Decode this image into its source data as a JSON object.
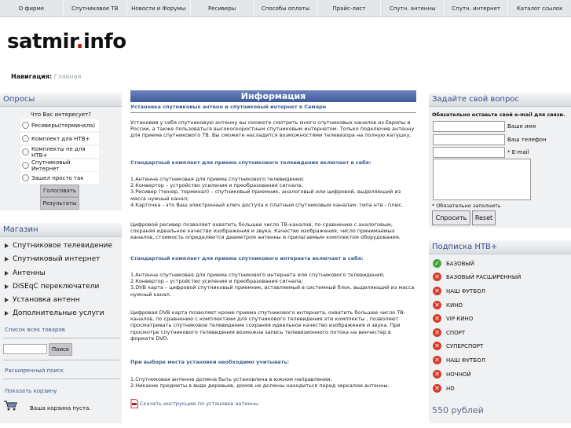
{
  "topnav": [
    "О фирме",
    "Спутниковое ТВ",
    "Новости и Форумы",
    "Ресиверы",
    "Способы оплаты",
    "Прайс-лист",
    "Спутн. антенны",
    "Спутн. интернет",
    "Каталог ссылок"
  ],
  "logo": {
    "main": "satmir",
    "dot": ".",
    "tld": "info"
  },
  "breadcrumb": {
    "label": "Навигация:",
    "home": "Главная"
  },
  "polls": {
    "title": "Опросы",
    "question": "Что Вас интересует?",
    "options": [
      "Ресиверы(терминала)",
      "Комплект для НТВ+",
      "Комплекты не для НТВ+",
      "Спутниковый Интернет",
      "Зашел просто так"
    ],
    "vote": "Голосовать",
    "results": "Результаты"
  },
  "shop": {
    "title": "Магазин",
    "items": [
      "Спутниковое телевидение",
      "Спутниковый интернет",
      "Антенны",
      "DiSEqC переключатели",
      "Установка антенн",
      "Дополнительные услуги"
    ],
    "all_products": "Список всех товаров",
    "search_btn": "Поиск",
    "advanced_search": "Расширенный поиск",
    "show_cart": "Показать корзину",
    "cart_empty": "Ваша корзина пуста."
  },
  "info": {
    "title": "Информация",
    "subtitle": "Установка спутниковых антенн и спутниковый интернет в Самаре",
    "p1": "Установив у себя спутниковую антенну вы сможете смотреть много спутниковых каналов из Европы и России, а также пользоваться высокоскоростным спутниковым интернетом. Только подключив антенну для приема спутникового ТВ. Вы сможете насладится возможностями телевизора на полную катушку.",
    "h1": "Стандартный комплект для приема спутникового телевидения включает в себя:",
    "list1": [
      "1.Антенна спутниковая для приема спутникового телевидения;",
      "2.Конвертор – устройство усиления и преобразования сигнала;",
      "3.Ресивер (тюнер, терминал) – спутниковый приемник, аналоговый или цифровой, выделяющий из масса нужный канал;",
      "4.Карточка - это Ваш электронный ключ доступа к платным спутниковым каналам. типа нтв - плюс."
    ],
    "p2": "Цифровой ресивер позволяет охватить большее число ТВ-каналов, по сравнению с аналоговым, сохраняя идеальное качество изображения и звука. Качество изображения, число принимаемых каналов, стоимость определяются диаметром антенны и прилагаемым комплектом оборудования.",
    "h2": "Стандартный комплект для приема спутникового интернета включает в себя:",
    "list2": [
      "1.Антенна спутниковая для приема спутникового интернета или спутникового телевидения;",
      "2.Конвертор – устройство усиления и преобразования сигнала;",
      "3.DVB карта – цифровой спутниковый приемник, вставляемый в системный блок, выделяющий из масса нужный канал."
    ],
    "p3": "Цифровая DVB карта позволяет кроме приема спутникового интернета, охватить большее число ТВ-каналов, по сравнению с комплектами для спутникового телевидения эти комплекты , позволяют просматривать спутниковое телевидение сохраняя идеальное качество изображения и звука. При просмотре спутникового телевидения возможна запись телевизионного потока на винчестер в формате DVD.",
    "h3": "При выборе места установки необходимо учитывать:",
    "list3": [
      "1.Спутниковая антенна должна быть установлена в южном направлении;",
      "2.Никакие предметы в виде деревьев, домов не должны находиться перед зеркалом антенны."
    ],
    "download": "Скачать инструкцию по установке антенны"
  },
  "ask": {
    "title": "Задайте свой вопрос",
    "note": "Обязательно оставьте свой e-mail для связи.",
    "name": "Ваше имя",
    "phone": "Ваш телефон",
    "email": "* E-mail",
    "required": "* Обязательно заполнить",
    "send": "Спросить",
    "reset": "Reset"
  },
  "subscription": {
    "title": "Подписка НТВ+",
    "packages": [
      {
        "name": "БАЗОВЫЙ",
        "status": "ok"
      },
      {
        "name": "БАЗОВЫЙ РАСШИРЕННЫЙ",
        "status": "no"
      },
      {
        "name": "НАШ ФУТБОЛ",
        "status": "no"
      },
      {
        "name": "КИНО",
        "status": "no"
      },
      {
        "name": "VIP КИНО",
        "status": "no"
      },
      {
        "name": "СПОРТ",
        "status": "no"
      },
      {
        "name": "СУПЕРСПОРТ",
        "status": "no"
      },
      {
        "name": "НАШ ФУТБОЛ",
        "status": "no"
      },
      {
        "name": "НОЧНОЙ",
        "status": "no"
      },
      {
        "name": "HD",
        "status": "no"
      }
    ],
    "price": "550 рублей"
  }
}
